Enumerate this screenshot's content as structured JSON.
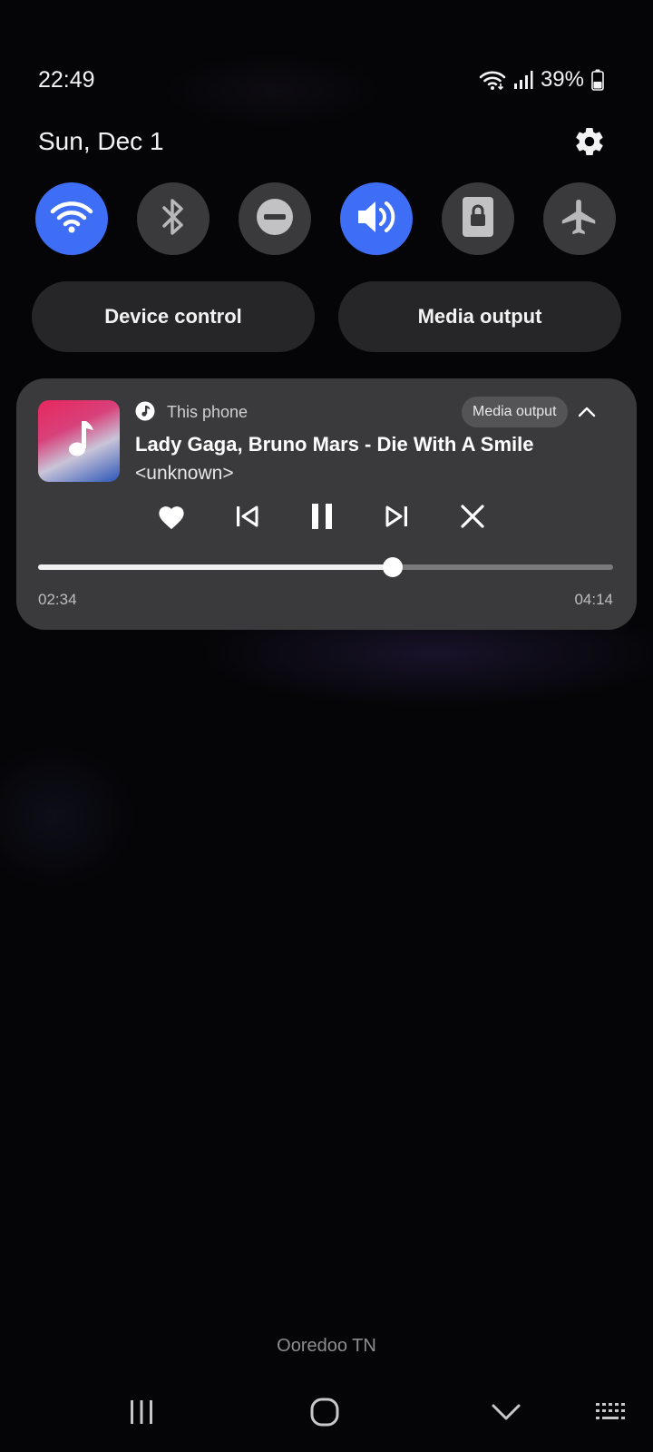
{
  "status_bar": {
    "time": "22:49",
    "battery_percent": "39%",
    "icons": [
      "wifi-icon",
      "signal-icon",
      "battery-icon"
    ]
  },
  "panel": {
    "date": "Sun, Dec 1",
    "settings_icon": "gear-icon"
  },
  "quick_toggles": [
    {
      "name": "wifi",
      "icon": "wifi-icon",
      "active": true
    },
    {
      "name": "bluetooth",
      "icon": "bluetooth-icon",
      "active": false
    },
    {
      "name": "do-not-disturb",
      "icon": "dnd-icon",
      "active": false
    },
    {
      "name": "sound",
      "icon": "volume-icon",
      "active": true
    },
    {
      "name": "portrait-lock",
      "icon": "rotation-lock-icon",
      "active": false
    },
    {
      "name": "airplane-mode",
      "icon": "airplane-icon",
      "active": false
    }
  ],
  "buttons": {
    "device_control": "Device control",
    "media_output": "Media output"
  },
  "media": {
    "source": "This phone",
    "output_chip": "Media output",
    "title": "Lady Gaga, Bruno Mars - Die With A Smile",
    "artist": "<unknown>",
    "elapsed": "02:34",
    "total": "04:14",
    "progress_fraction": 0.616,
    "controls": [
      "heart-icon",
      "previous-icon",
      "pause-icon",
      "next-icon",
      "close-icon"
    ]
  },
  "carrier": "Ooredoo TN",
  "colors": {
    "accent": "#3d6ef5",
    "toggle_off": "#3a3a3c",
    "card": "#3a3a3c",
    "background": "#050507"
  }
}
